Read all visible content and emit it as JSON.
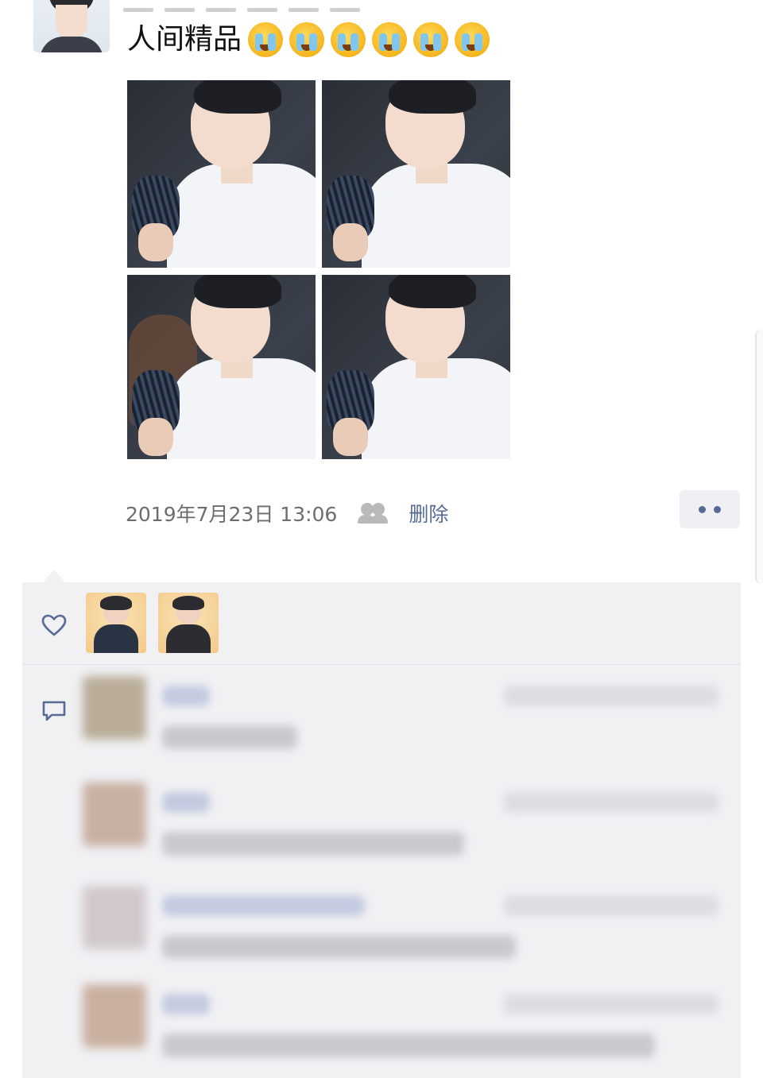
{
  "post": {
    "text": "人间精品",
    "emoji_name": "crying-face-emoji",
    "emoji_count": 6,
    "image_count": 4,
    "timestamp": "2019年7月23日 13:06",
    "delete_label": "删除"
  },
  "interactions": {
    "like_count": 2,
    "comments_blurred": 4
  },
  "colors": {
    "link": "#576b95",
    "timestamp": "#6d6d6d",
    "panel_bg": "#f1f1f4"
  }
}
